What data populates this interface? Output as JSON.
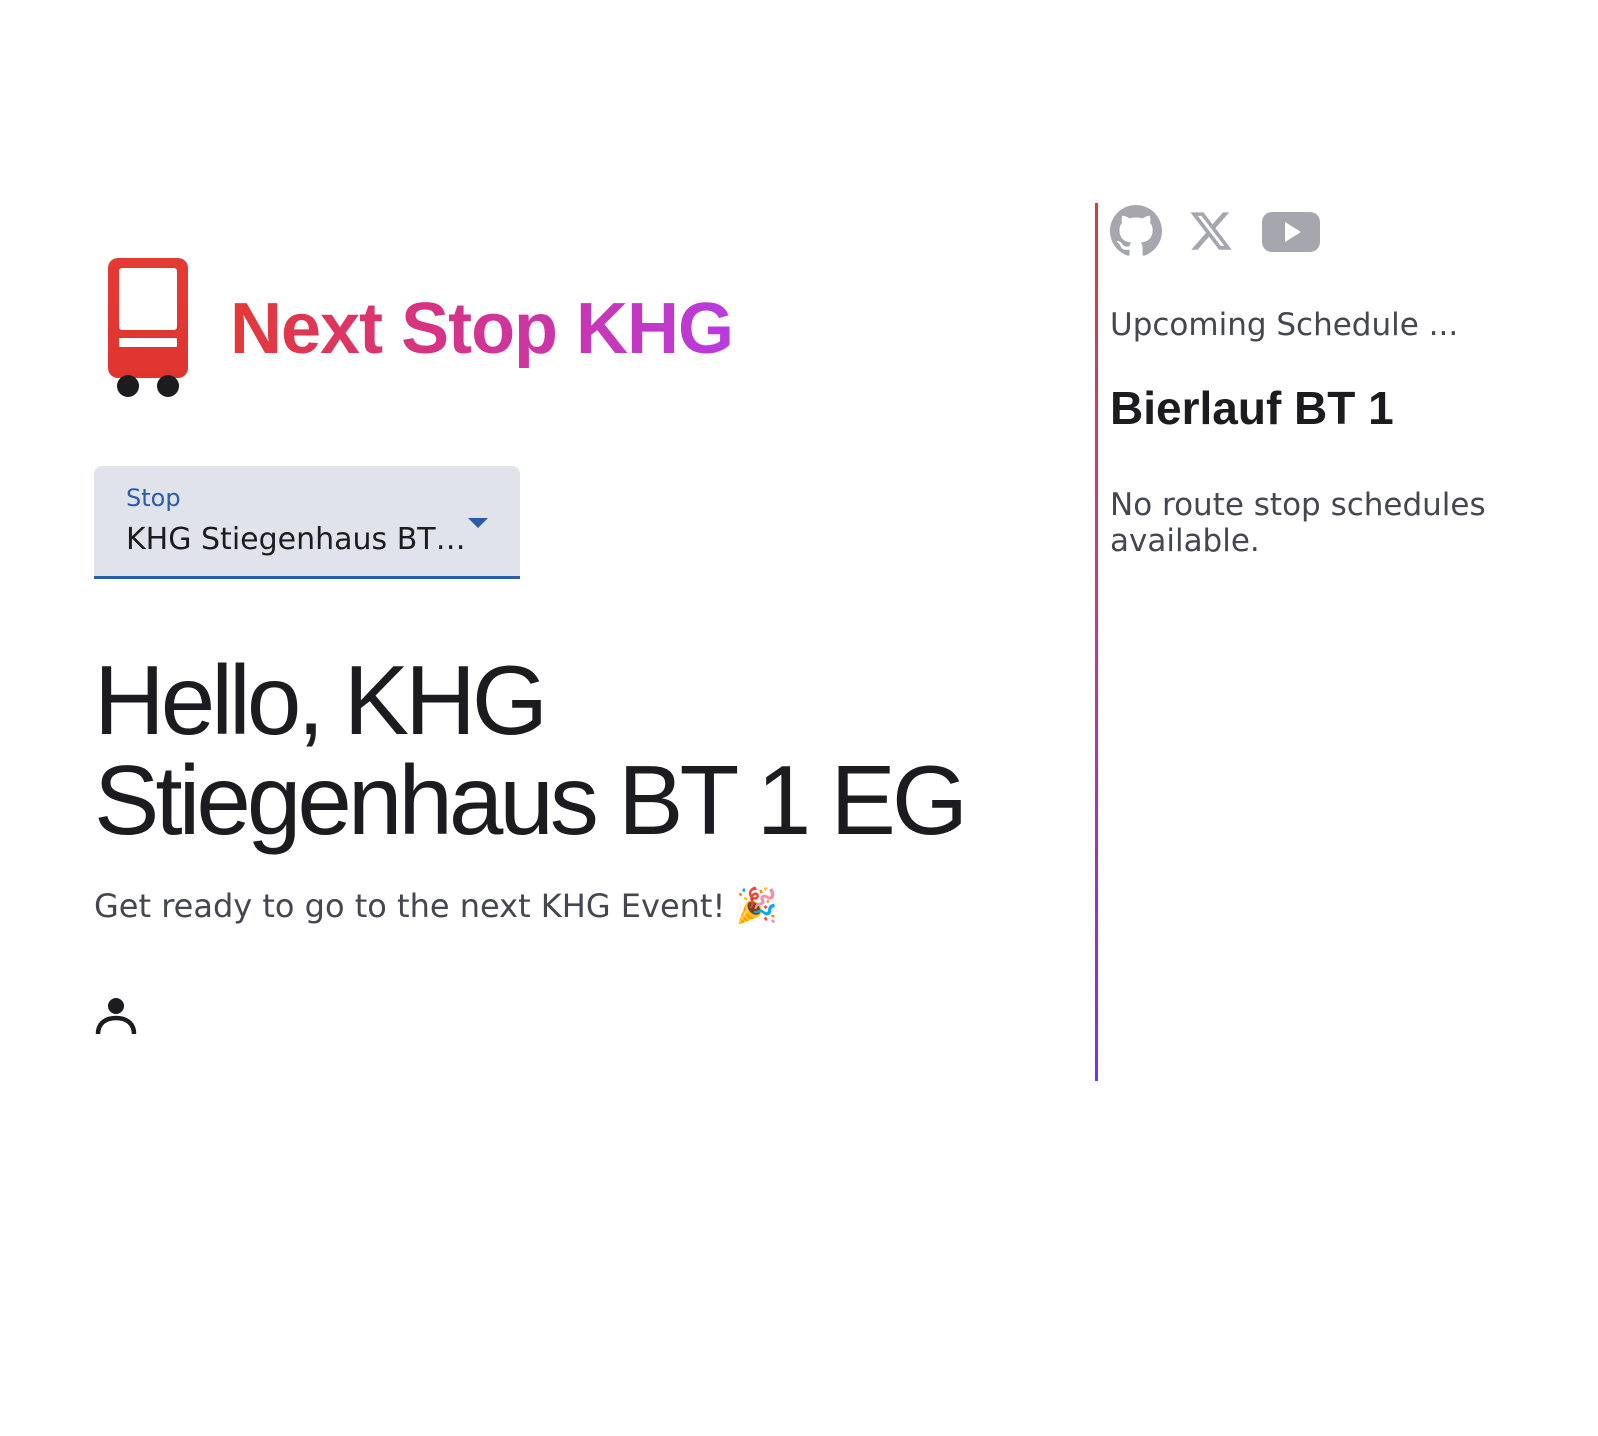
{
  "brand": {
    "title": "Next Stop KHG",
    "logo_icon": "tram-icon",
    "gradient_start": "#e53935",
    "gradient_end": "#b83be0"
  },
  "stop_select": {
    "label": "Stop",
    "value": "KHG Stiegenhaus BT 1 EG",
    "display_value": "KHG Stiegenhaus BT…",
    "accent": "#2a5caa"
  },
  "greeting": {
    "heading": "Hello, KHG Stiegenhaus BT 1 EG",
    "tagline": "Get ready to go to the next KHG Event!",
    "tagline_emoji": "🎉"
  },
  "account": {
    "icon": "person-icon"
  },
  "socials": [
    {
      "icon": "github-icon"
    },
    {
      "icon": "x-icon"
    },
    {
      "icon": "youtube-icon"
    }
  ],
  "schedule": {
    "heading": "Upcoming Schedule ...",
    "event_title": "Bierlauf BT 1",
    "empty_message": "No route stop schedules available."
  }
}
